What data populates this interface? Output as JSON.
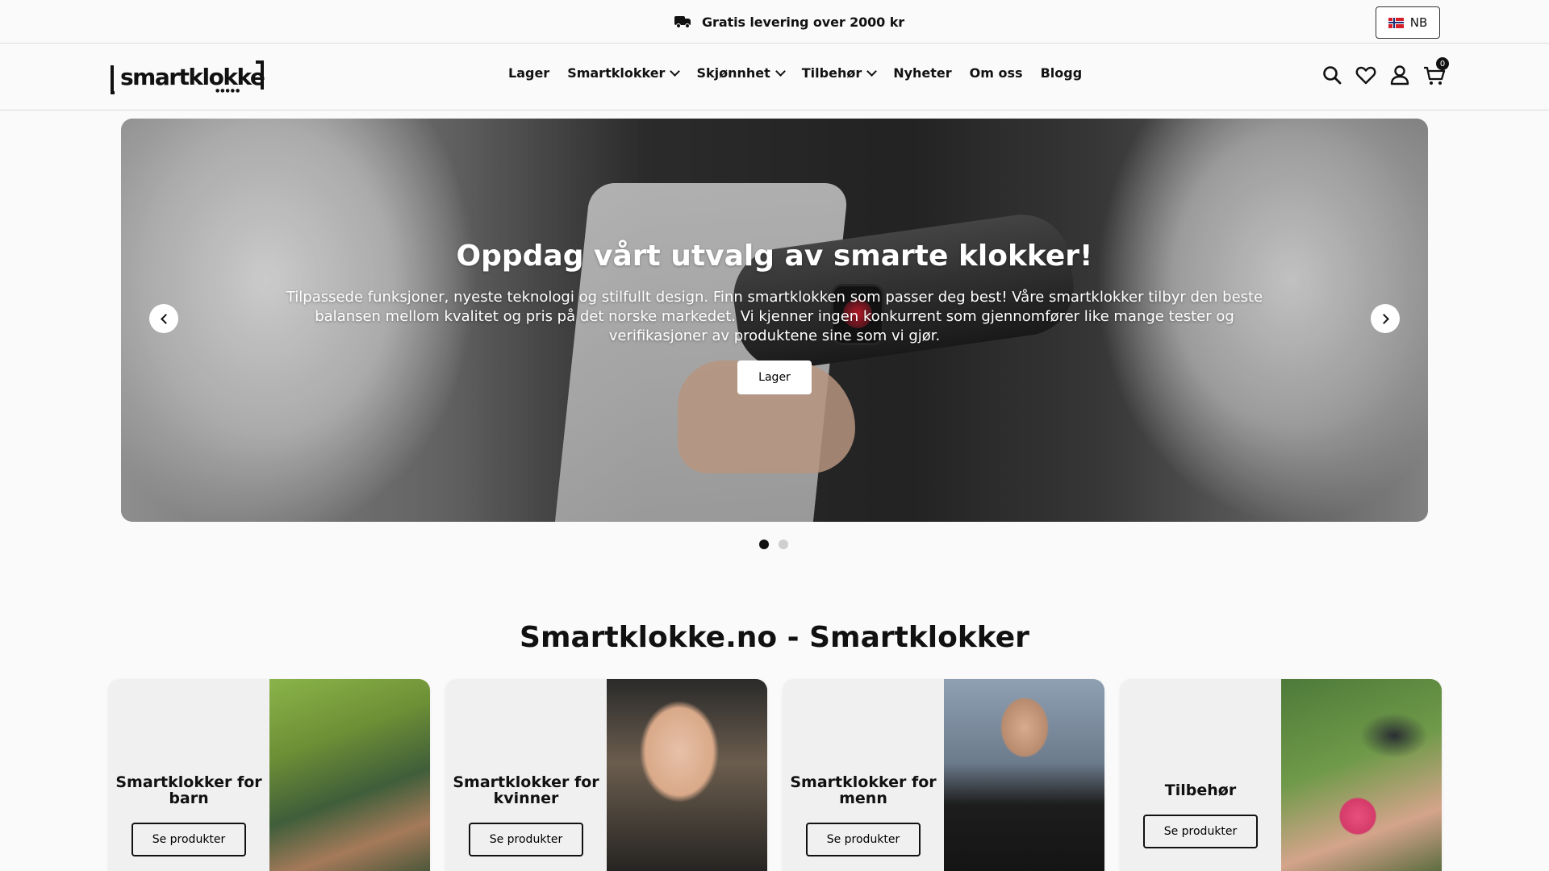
{
  "topbar": {
    "promo_text": "Gratis levering over 2000 kr",
    "language": "NB"
  },
  "header": {
    "logo_text": "smartklokke",
    "nav": [
      {
        "label": "Lager",
        "has_dropdown": false
      },
      {
        "label": "Smartklokker",
        "has_dropdown": true
      },
      {
        "label": "Skjønnhet",
        "has_dropdown": true
      },
      {
        "label": "Tilbehør",
        "has_dropdown": true
      },
      {
        "label": "Nyheter",
        "has_dropdown": false
      },
      {
        "label": "Om oss",
        "has_dropdown": false
      },
      {
        "label": "Blogg",
        "has_dropdown": false
      }
    ],
    "icons": [
      "search-icon",
      "heart-icon",
      "user-icon",
      "cart-icon"
    ],
    "cart_count": "0"
  },
  "hero": {
    "title": "Oppdag vårt utvalg av smarte klokker!",
    "text": "Tilpassede funksjoner, nyeste teknologi og stilfullt design. Finn smartklokken som passer deg best! Våre smartklokker tilbyr den beste balansen mellom kvalitet og pris på det norske markedet. Vi kjenner ingen konkurrent som gjennomfører like mange tester og verifikasjoner av produktene sine som vi gjør.",
    "button_label": "Lager",
    "slide_count": 2,
    "active_slide": 1
  },
  "section": {
    "title": "Smartklokke.no - Smartklokker"
  },
  "cards": [
    {
      "title": "Smartklokker for barn",
      "button": "Se produkter"
    },
    {
      "title": "Smartklokker for kvinner",
      "button": "Se produkter"
    },
    {
      "title": "Smartklokker for menn",
      "button": "Se produkter"
    },
    {
      "title": "Tilbehør",
      "button": "Se produkter"
    }
  ],
  "colors": {
    "background": "#fafafa",
    "text": "#111111",
    "card_bg": "#f0f0f0"
  }
}
